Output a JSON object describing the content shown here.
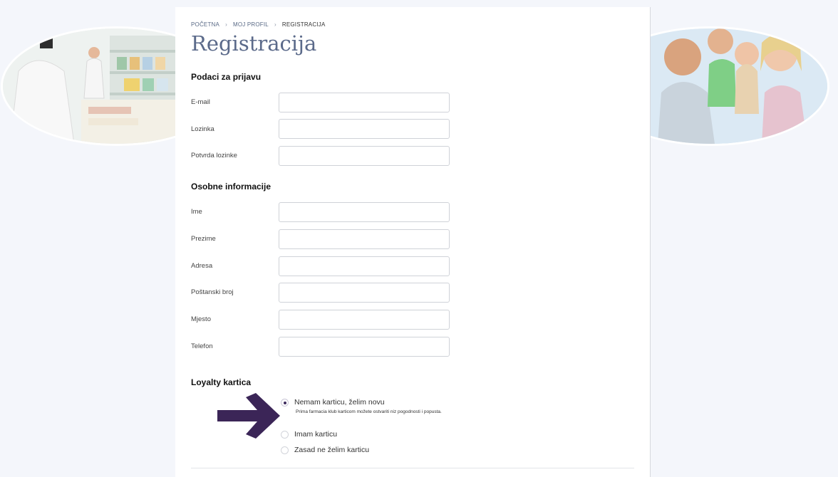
{
  "breadcrumb": {
    "items": [
      "POČETNA",
      "MOJ PROFIL"
    ],
    "current": "REGISTRACIJA",
    "separator": "›"
  },
  "page": {
    "title": "Registracija"
  },
  "login_section": {
    "title": "Podaci za prijavu",
    "fields": [
      {
        "label": "E-mail",
        "value": "",
        "placeholder": ""
      },
      {
        "label": "Lozinka",
        "value": "",
        "placeholder": ""
      },
      {
        "label": "Potvrda lozinke",
        "value": "",
        "placeholder": ""
      }
    ]
  },
  "personal_section": {
    "title": "Osobne informacije",
    "fields": [
      {
        "label": "Ime",
        "value": "",
        "placeholder": ""
      },
      {
        "label": "Prezime",
        "value": "",
        "placeholder": ""
      },
      {
        "label": "Adresa",
        "value": "",
        "placeholder": ""
      },
      {
        "label": "Poštanski broj",
        "value": "",
        "placeholder": ""
      },
      {
        "label": "Mjesto",
        "value": "",
        "placeholder": ""
      },
      {
        "label": "Telefon",
        "value": "",
        "placeholder": ""
      }
    ]
  },
  "loyalty_section": {
    "title": "Loyalty kartica",
    "options": [
      {
        "label": "Nemam karticu, želim novu",
        "checked": true,
        "hint": "Prima farmacia klub karticom možete ostvariti niz pogodnosti i popusta."
      },
      {
        "label": "Imam karticu",
        "checked": false
      },
      {
        "label": "Zasad ne želim karticu",
        "checked": false
      }
    ]
  },
  "colors": {
    "title": "#5b6a8a",
    "arrow": "#3b2557",
    "radio_dot": "#3d2a5c",
    "page_bg": "#f4f6fb"
  },
  "icons": {
    "arrow": "arrow-right-icon",
    "left_photo": "pharmacist-photo",
    "right_photo": "family-photo"
  }
}
